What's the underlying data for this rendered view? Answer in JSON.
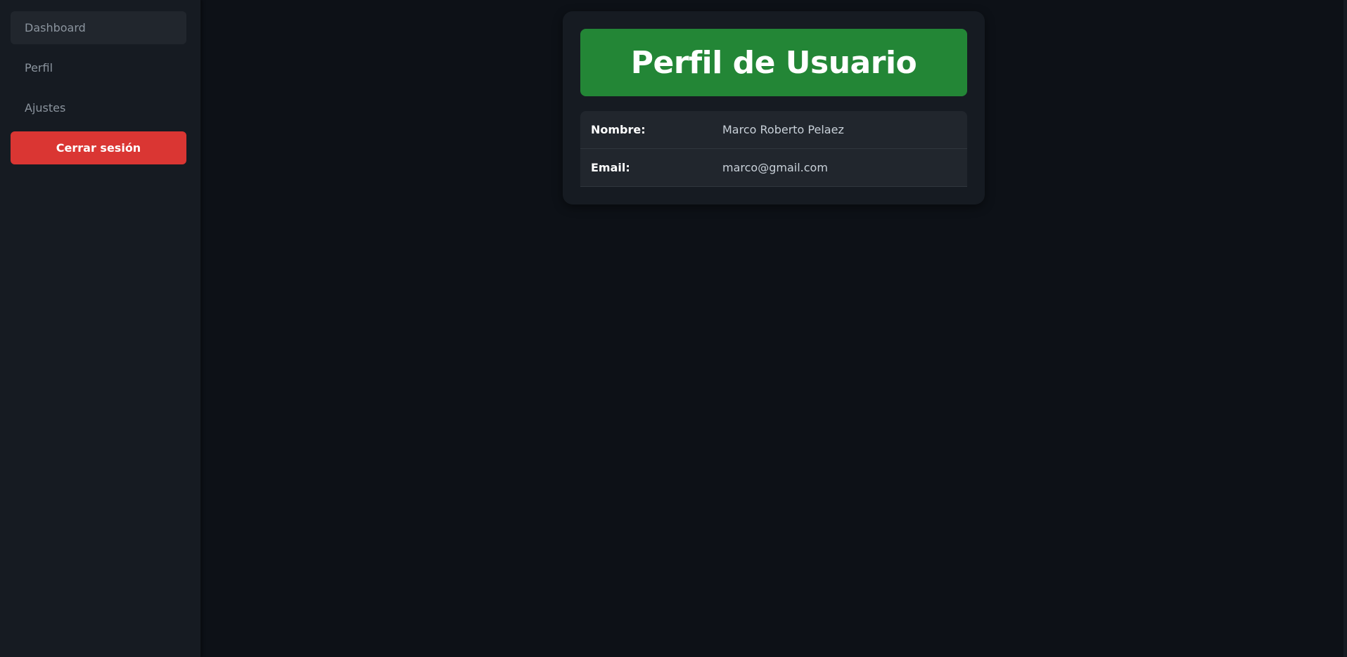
{
  "sidebar": {
    "items": [
      {
        "label": "Dashboard",
        "active": true
      },
      {
        "label": "Perfil",
        "active": false
      },
      {
        "label": "Ajustes",
        "active": false
      }
    ],
    "logout_label": "Cerrar sesión"
  },
  "profile": {
    "title": "Perfil de Usuario",
    "rows": [
      {
        "label": "Nombre:",
        "value": "Marco Roberto Pelaez"
      },
      {
        "label": "Email:",
        "value": "marco@gmail.com"
      }
    ]
  },
  "colors": {
    "background": "#0d1117",
    "sidebar": "#161b22",
    "header_green": "#238636",
    "logout_red": "#da3633"
  }
}
